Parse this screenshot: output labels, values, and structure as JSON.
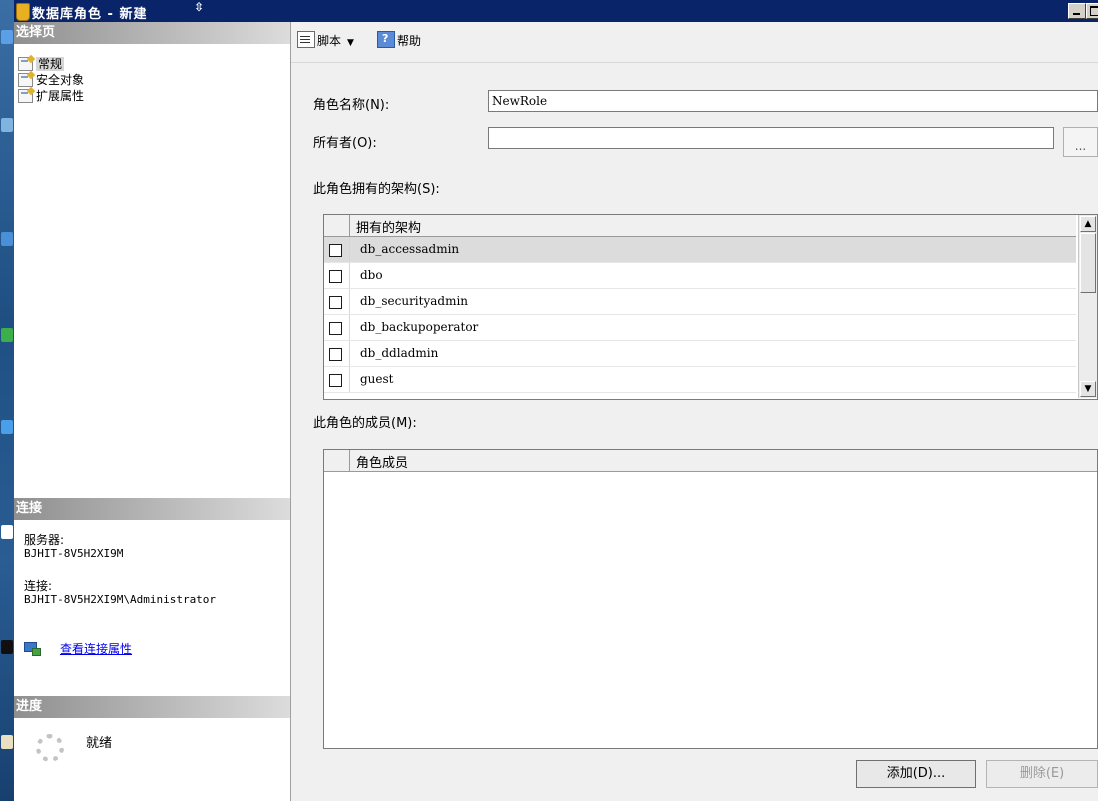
{
  "window": {
    "title": "数据库角色 - 新建",
    "pointer_glyph": "⇳"
  },
  "select_page": {
    "header": "选择页",
    "items": [
      {
        "label": "常规",
        "selected": true
      },
      {
        "label": "安全对象",
        "selected": false
      },
      {
        "label": "扩展属性",
        "selected": false
      }
    ]
  },
  "connection": {
    "header": "连接",
    "server_label": "服务器:",
    "server_value": "BJHIT-8V5H2XI9M",
    "conn_label": "连接:",
    "conn_value": "BJHIT-8V5H2XI9M\\Administrator",
    "view_properties_link": "查看连接属性"
  },
  "progress": {
    "header": "进度",
    "status": "就绪"
  },
  "toolbar": {
    "script_label": "脚本",
    "script_caret": "▼",
    "help_label": "帮助"
  },
  "form": {
    "role_name_label": "角色名称(N):",
    "role_name_value": "NewRole",
    "owner_label": "所有者(O):",
    "owner_value": "",
    "owner_browse_label": "...",
    "owned_schemas_label": "此角色拥有的架构(S):",
    "members_label": "此角色的成员(M):"
  },
  "owned_schemas_grid": {
    "column_header": "拥有的架构",
    "rows": [
      {
        "name": "db_accessadmin",
        "checked": false,
        "selected": true
      },
      {
        "name": "dbo",
        "checked": false,
        "selected": false
      },
      {
        "name": "db_securityadmin",
        "checked": false,
        "selected": false
      },
      {
        "name": "db_backupoperator",
        "checked": false,
        "selected": false
      },
      {
        "name": "db_ddladmin",
        "checked": false,
        "selected": false
      },
      {
        "name": "guest",
        "checked": false,
        "selected": false
      }
    ],
    "scroll_up_glyph": "▲",
    "scroll_down_glyph": "▼"
  },
  "members_grid": {
    "column_header": "角色成员",
    "rows": []
  },
  "buttons": {
    "add_label": "添加(D)...",
    "remove_label": "删除(E)"
  },
  "colors": {
    "title_bar": "#0a246a",
    "section_header_start": "#8f8f8f",
    "link": "#0000ee",
    "selected_row": "#dcdcdc"
  }
}
